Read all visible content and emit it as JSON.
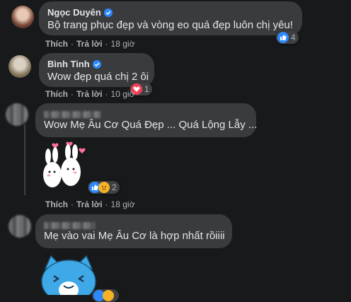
{
  "comments": [
    {
      "author": "Ngọc Duyên",
      "verified": true,
      "text": "Bộ trang phục đẹp và vòng eo quá đẹp luôn chị yêu!",
      "like_label": "Thích",
      "reply_label": "Trả lời",
      "time": "18 giờ",
      "reaction_count": "4",
      "reaction_icon": "like-icon"
    },
    {
      "author": "Bình Tinh",
      "verified": true,
      "text": "Wow đẹp quá chị 2 ôi",
      "like_label": "Thích",
      "reply_label": "Trả lời",
      "time": "10 giờ",
      "reaction_count": "1",
      "reaction_icon": "love-icon"
    },
    {
      "author": "",
      "verified": false,
      "text": "Wow Mẹ Âu Cơ Quá Đẹp ... Quá Lộng Lẫy ...",
      "sticker": "bunny-hearts-sticker",
      "like_label": "Thích",
      "reply_label": "Trả lời",
      "time": "18 giờ",
      "reaction_count": "2",
      "reaction_icon": "like-sad-icons"
    },
    {
      "author": "",
      "verified": false,
      "text": "Mẹ vào vai Mẹ Âu Cơ là hợp nhất rồiiii",
      "sticker": "blue-cat-sticker",
      "reaction_icon": "like-haha-icons"
    }
  ],
  "colors": {
    "background": "#18191a",
    "bubble": "#3a3b3c",
    "like": "#2d88ff",
    "love": "#f33e58",
    "verified": "#2d88ff"
  }
}
